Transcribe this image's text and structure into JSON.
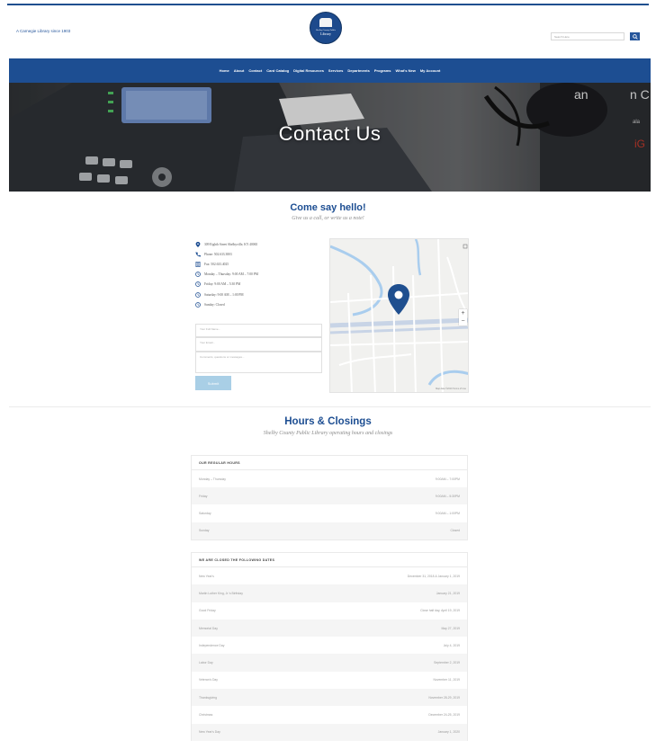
{
  "header": {
    "tagline": "A Carnegie Library since 1903",
    "logo_name": "Shelby County Public",
    "logo_word": "Library",
    "search_placeholder": "Search Here"
  },
  "nav": {
    "items": [
      "Home",
      "About",
      "Contact",
      "Card Catalog",
      "Digital Resources",
      "Services",
      "Departments",
      "Programs",
      "What's New",
      "My Account"
    ]
  },
  "hero": {
    "title": "Contact Us"
  },
  "contact": {
    "title": "Come say hello!",
    "subtitle": "Give us a call, or write us a note!",
    "info": [
      {
        "icon": "location-pin-icon",
        "text": "309 Eighth Street Shelbyville, KY 40065"
      },
      {
        "icon": "phone-icon",
        "text": "Phone: 502.633.3803"
      },
      {
        "icon": "fax-icon",
        "text": "Fax: 502.633.4025"
      },
      {
        "icon": "clock-icon",
        "text": "Monday – Thursday: 9:00 AM – 7:00 PM"
      },
      {
        "icon": "clock-icon",
        "text": "Friday: 9:00 AM – 5:30 PM"
      },
      {
        "icon": "clock-icon",
        "text": "Saturday: 9:00 AM – 1:00 PM"
      },
      {
        "icon": "clock-icon",
        "text": "Sunday: Closed"
      }
    ],
    "form": {
      "name_placeholder": "Your Full Name...",
      "email_placeholder": "Your Email...",
      "message_placeholder": "Comments, questions or messages...",
      "submit_label": "Submit"
    },
    "map_attribution": "Map data ©2019   Terms of Use"
  },
  "hours": {
    "title": "Hours & Closings",
    "subtitle": "Shelby County Public Library operating hours and closings",
    "regular": {
      "heading": "OUR REGULAR HOURS",
      "rows": [
        {
          "day": "Monday – Thursday",
          "time": "9:00AM – 7:00PM"
        },
        {
          "day": "Friday",
          "time": "9:00AM – 5:30PM"
        },
        {
          "day": "Saturday",
          "time": "9:00AM – 1:00PM"
        },
        {
          "day": "Sunday",
          "time": "Closed"
        }
      ]
    },
    "closed": {
      "heading": "WE ARE CLOSED THE FOLLOWING DATES",
      "rows": [
        {
          "day": "New Year's",
          "date": "December 31, 2018 & January 1, 2019"
        },
        {
          "day": "Martin Luther King, Jr.'s Birthday",
          "date": "January 21, 2019"
        },
        {
          "day": "Good Friday",
          "date": "Close half day, April 19, 2019"
        },
        {
          "day": "Memorial Day",
          "date": "May 27, 2019"
        },
        {
          "day": "Independence Day",
          "date": "July 4, 2019"
        },
        {
          "day": "Labor Day",
          "date": "September 2, 2019"
        },
        {
          "day": "Veteran's Day",
          "date": "November 11, 2019"
        },
        {
          "day": "Thanksgiving",
          "date": "November 28-29, 2019"
        },
        {
          "day": "Christmas",
          "date": "December 24-25, 2019"
        },
        {
          "day": "New Year's Day",
          "date": "January 1, 2020"
        }
      ]
    }
  },
  "colors": {
    "brand_blue": "#1d4e92",
    "button_light_blue": "#a9cfe6",
    "map_pin": "#1f4f8f"
  }
}
